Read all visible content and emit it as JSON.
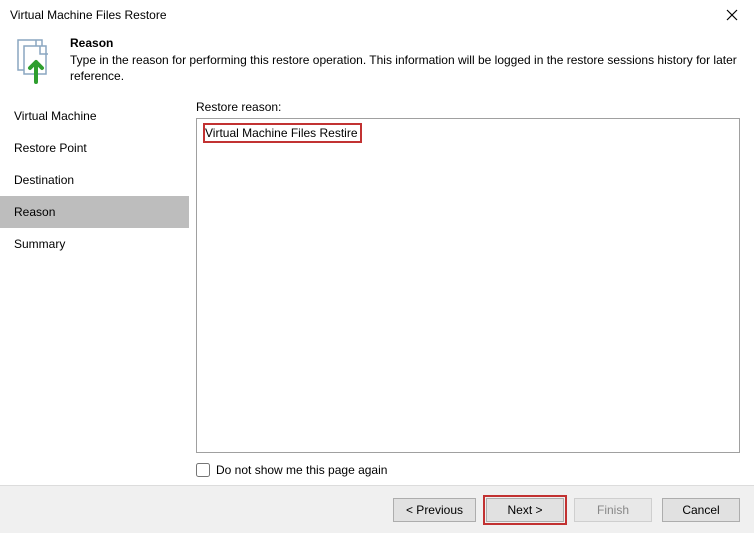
{
  "window": {
    "title": "Virtual Machine Files Restore"
  },
  "header": {
    "heading": "Reason",
    "description": "Type in the reason for performing this restore operation. This information will be logged in the restore sessions history for later reference."
  },
  "sidebar": {
    "items": [
      {
        "label": "Virtual Machine"
      },
      {
        "label": "Restore Point"
      },
      {
        "label": "Destination"
      },
      {
        "label": "Reason"
      },
      {
        "label": "Summary"
      }
    ],
    "active_index": 3
  },
  "main": {
    "reason_label": "Restore reason:",
    "reason_value": "Virtual Machine Files Restire",
    "dont_show_label": "Do not show me this page again",
    "dont_show_checked": false
  },
  "footer": {
    "previous": "< Previous",
    "next": "Next >",
    "finish": "Finish",
    "cancel": "Cancel"
  }
}
